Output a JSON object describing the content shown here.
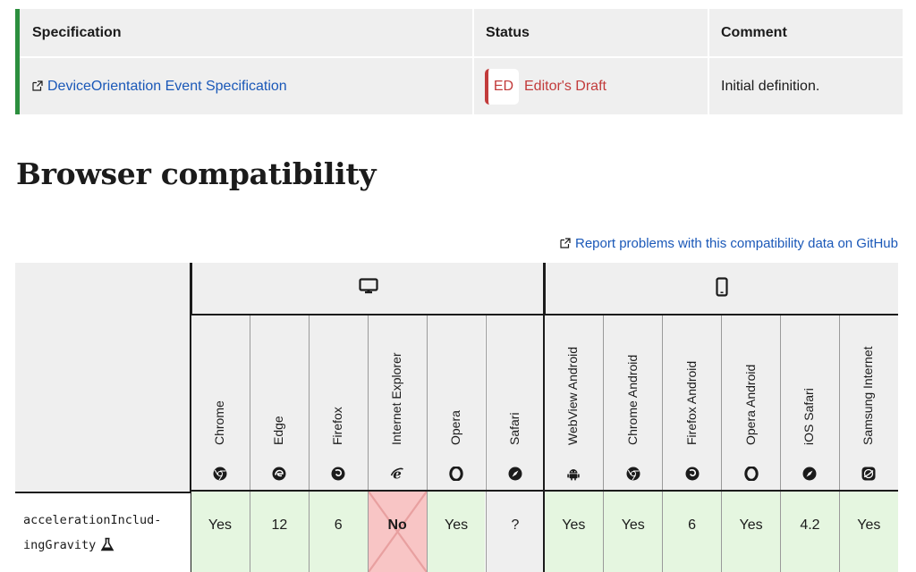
{
  "spec_table": {
    "headers": {
      "specification": "Specification",
      "status": "Status",
      "comment": "Comment"
    },
    "row": {
      "spec_link": "DeviceOrientation Event Specification",
      "status_abbr": "ED",
      "status_label": "Editor's Draft",
      "comment": "Initial definition."
    },
    "accent_color": "#2c8f3e",
    "status_color": "#c23b3b"
  },
  "section_heading": "Browser compatibility",
  "report_link": "Report problems with this compatibility data on GitHub",
  "compat": {
    "groups": [
      {
        "name": "desktop",
        "icon": "desktop-icon"
      },
      {
        "name": "mobile",
        "icon": "mobile-icon"
      }
    ],
    "browsers": [
      {
        "name": "Chrome",
        "icon": "chrome-icon"
      },
      {
        "name": "Edge",
        "icon": "edge-icon"
      },
      {
        "name": "Firefox",
        "icon": "firefox-icon"
      },
      {
        "name": "Internet Explorer",
        "icon": "ie-icon"
      },
      {
        "name": "Opera",
        "icon": "opera-icon"
      },
      {
        "name": "Safari",
        "icon": "safari-icon"
      },
      {
        "name": "WebView Android",
        "icon": "android-icon"
      },
      {
        "name": "Chrome Android",
        "icon": "chrome-icon"
      },
      {
        "name": "Firefox Android",
        "icon": "firefox-icon"
      },
      {
        "name": "Opera Android",
        "icon": "opera-icon"
      },
      {
        "name": "iOS Safari",
        "icon": "safari-icon"
      },
      {
        "name": "Samsung Internet",
        "icon": "samsung-icon"
      }
    ],
    "feature": {
      "name_line1": "accelerationInclud-",
      "name_line2": "ingGravity",
      "flag_icon": "experimental-flask-icon",
      "support": [
        {
          "value": "Yes",
          "state": "yes"
        },
        {
          "value": "12",
          "state": "yes"
        },
        {
          "value": "6",
          "state": "yes"
        },
        {
          "value": "No",
          "state": "no"
        },
        {
          "value": "Yes",
          "state": "yes"
        },
        {
          "value": "?",
          "state": "unknown"
        },
        {
          "value": "Yes",
          "state": "yes"
        },
        {
          "value": "Yes",
          "state": "yes"
        },
        {
          "value": "6",
          "state": "yes"
        },
        {
          "value": "Yes",
          "state": "yes"
        },
        {
          "value": "4.2",
          "state": "yes"
        },
        {
          "value": "Yes",
          "state": "yes"
        }
      ]
    },
    "colors": {
      "yes": "#e5f6e0",
      "no": "#f8c5c5",
      "unknown": "#efefef"
    }
  }
}
